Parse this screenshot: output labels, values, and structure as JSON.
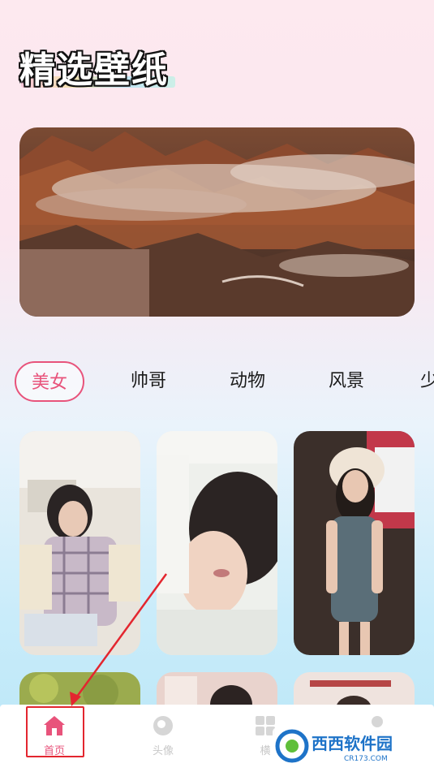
{
  "header": {
    "title": "精选壁纸"
  },
  "tabs": [
    {
      "label": "美女",
      "active": true
    },
    {
      "label": "帅哥",
      "active": false
    },
    {
      "label": "动物",
      "active": false
    },
    {
      "label": "风景",
      "active": false
    },
    {
      "label": "少",
      "active": false
    }
  ],
  "banner": {
    "image": "coastal-mountains-fog-photo"
  },
  "wallpapers": [
    {
      "image": "girl-reading-magazine"
    },
    {
      "image": "girl-lying-smiling"
    },
    {
      "image": "woman-earmuffs-denim-dress"
    },
    {
      "image": "girl-outdoors-greenery"
    },
    {
      "image": "girl-indoor-pink"
    },
    {
      "image": "indoor-scene"
    }
  ],
  "bottom_nav": {
    "items": [
      {
        "label": "首页",
        "icon": "home-icon",
        "active": true
      },
      {
        "label": "头像",
        "icon": "avatar-icon",
        "active": false
      },
      {
        "label": "横",
        "icon": "grid-icon",
        "active": false
      },
      {
        "label": "",
        "icon": "profile-icon",
        "active": false
      }
    ]
  },
  "annotation": {
    "color": "#e3262f"
  },
  "watermark": {
    "brand": "西西软件园",
    "sub": "CR173.COM"
  },
  "colors": {
    "accent": "#e8537b",
    "annotation": "#e3262f"
  }
}
